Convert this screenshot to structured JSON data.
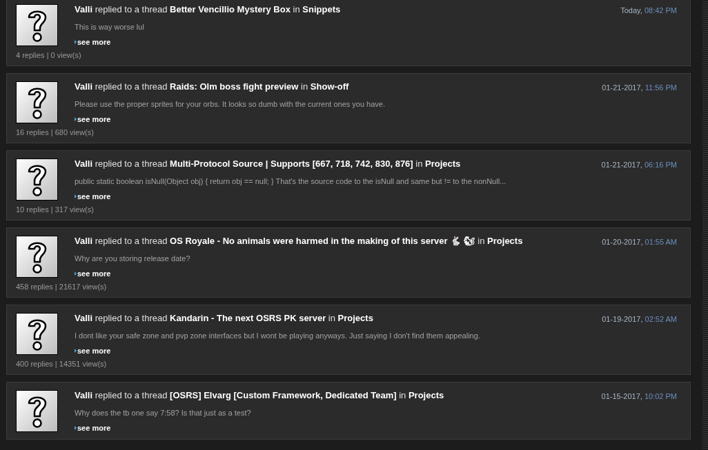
{
  "posts": [
    {
      "user": "Valli",
      "action": "replied to a thread",
      "thread": "Better Vencillio Mystery Box",
      "in_word": "in",
      "forum": "Snippets",
      "date": "Today,",
      "time": "08:42 PM",
      "excerpt": "This is way worse lul",
      "see_more": "see more",
      "stats": "4 replies | 0 view(s)"
    },
    {
      "user": "Valli",
      "action": "replied to a thread",
      "thread": "Raids: Olm boss fight preview",
      "in_word": "in",
      "forum": "Show-off",
      "date": "01-21-2017,",
      "time": "11:56 PM",
      "excerpt": "Please use the proper sprites for your orbs. It looks so dumb with the current ones you have.",
      "see_more": "see more",
      "stats": "16 replies | 680 view(s)"
    },
    {
      "user": "Valli",
      "action": "replied to a thread",
      "thread": "Multi-Protocol Source | Supports [667, 718, 742, 830, 876]",
      "in_word": "in",
      "forum": "Projects",
      "date": "01-21-2017,",
      "time": "06:16 PM",
      "excerpt": "public static boolean isNull(Object obj) { return obj == null; } That's the source code to the isNull and same but != to the nonNull...",
      "see_more": "see more",
      "stats": "10 replies | 317 view(s)"
    },
    {
      "user": "Valli",
      "action": "replied to a thread",
      "thread": "OS Royale - No animals were harmed in the making of this server 🐇 🐿",
      "in_word": "in",
      "forum": "Projects",
      "date": "01-20-2017,",
      "time": "01:55 AM",
      "excerpt": "Why are you storing release date?",
      "see_more": "see more",
      "stats": "458 replies | 21617 view(s)"
    },
    {
      "user": "Valli",
      "action": "replied to a thread",
      "thread": "Kandarin - The next OSRS PK server",
      "in_word": "in",
      "forum": "Projects",
      "date": "01-19-2017,",
      "time": "02:52 AM",
      "excerpt": "I dont like your safe zone and pvp zone interfaces but I wont be playing anyways. Just saying I don't find them appealing.",
      "see_more": "see more",
      "stats": "400 replies | 14351 view(s)"
    },
    {
      "user": "Valli",
      "action": "replied to a thread",
      "thread": "[OSRS] Elvarg [Custom Framework, Dedicated Team]",
      "in_word": "in",
      "forum": "Projects",
      "date": "01-15-2017,",
      "time": "10:02 PM",
      "excerpt": "Why does the tb one say 7:58? Is that just as a test?",
      "see_more": "see more"
    }
  ]
}
